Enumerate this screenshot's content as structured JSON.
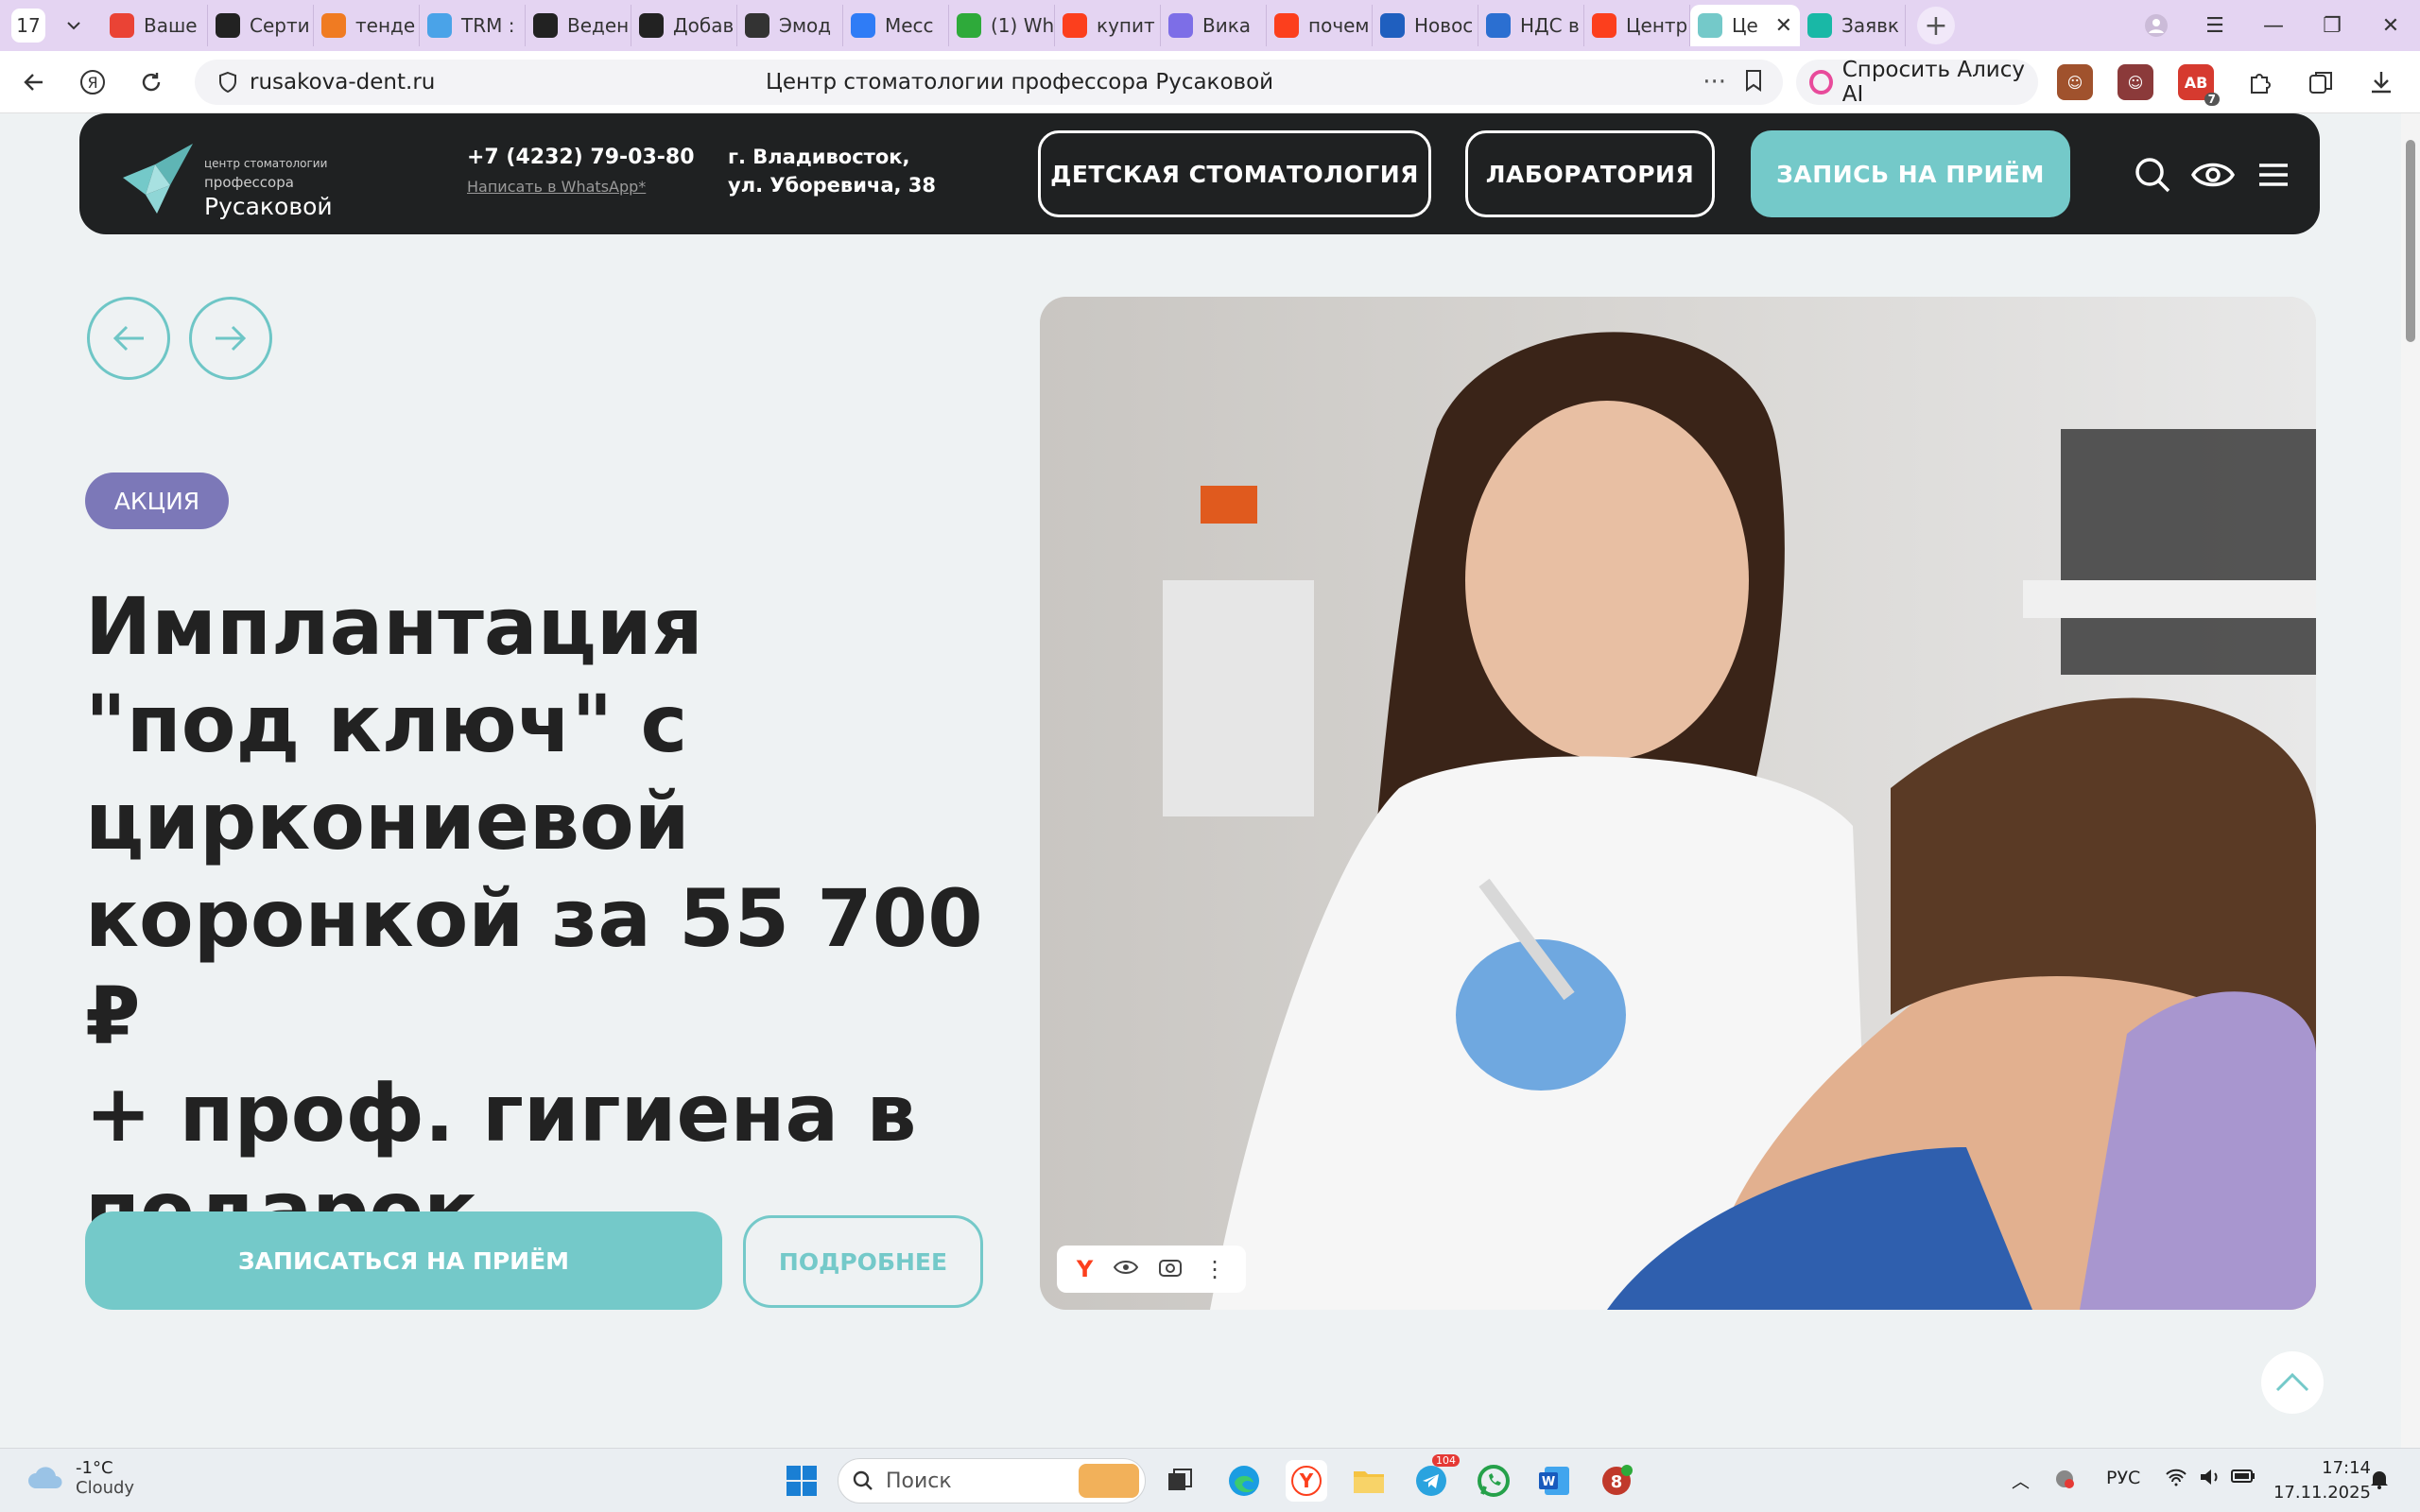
{
  "browser": {
    "tab_count": "17",
    "tabs": [
      {
        "label": "Ваше",
        "icon": "gmail-icon",
        "color": "#ea4335"
      },
      {
        "label": "Серти",
        "icon": "star-badge-icon",
        "color": "#222222"
      },
      {
        "label": "тенде",
        "icon": "mail-icon",
        "color": "#f07b22"
      },
      {
        "label": "TRM :",
        "icon": "trm-icon",
        "color": "#4aa3e8"
      },
      {
        "label": "Веден",
        "icon": "star-badge-icon",
        "color": "#222222"
      },
      {
        "label": "Добав",
        "icon": "star-badge-icon",
        "color": "#222222"
      },
      {
        "label": "Эмод",
        "icon": "openai-icon",
        "color": "#333333"
      },
      {
        "label": "Месс",
        "icon": "messenger-icon",
        "color": "#2f7cf6"
      },
      {
        "label": "(1) Wh",
        "icon": "green-one-icon",
        "color": "#2eaa3a"
      },
      {
        "label": "купит",
        "icon": "yandex-icon",
        "color": "#fc3f1d"
      },
      {
        "label": "Вика",
        "icon": "check-circle-icon",
        "color": "#7d6ee7"
      },
      {
        "label": "почем",
        "icon": "yandex-icon",
        "color": "#fc3f1d"
      },
      {
        "label": "Новос",
        "icon": "news-icon",
        "color": "#1f5fbf"
      },
      {
        "label": "НДС в",
        "icon": "percent-icon",
        "color": "#2b6fd1"
      },
      {
        "label": "Центр",
        "icon": "yandex-icon",
        "color": "#fc3f1d"
      },
      {
        "label": "Це",
        "icon": "origami-bird-icon",
        "color": "#74c9c9",
        "active": true
      },
      {
        "label": "Заявк",
        "icon": "star-green-icon",
        "color": "#19b8a6"
      }
    ],
    "url": "rusakova-dent.ru",
    "page_title": "Центр стоматологии профессора Русаковой",
    "alice_label": "Спросить Алису AI",
    "ext_badge": "7"
  },
  "site": {
    "logo": {
      "line1": "центр стоматологии",
      "line2": "профессора",
      "line3": "Русаковой"
    },
    "phone": "+7 (4232) 79-03-80",
    "whatsapp": "Написать в WhatsApp*",
    "address_line1": "г. Владивосток,",
    "address_line2": "ул. Уборевича, 38",
    "nav": {
      "kids": "ДЕТСКАЯ СТОМАТОЛОГИЯ",
      "lab": "ЛАБОРАТОРИЯ",
      "appointment": "ЗАПИСЬ НА ПРИЁМ"
    },
    "accent_color": "#74c9c9",
    "badge_color": "#7c78b8"
  },
  "hero": {
    "badge": "АКЦИЯ",
    "headline_lines": [
      "Имплантация",
      "\"под ключ\" с",
      "циркониевой",
      "коронкой за 55 700 ₽",
      "+ проф. гигиена в",
      "подарок"
    ],
    "cta_label": "ЗАПИСАТЬСЯ НА ПРИЁМ",
    "more_label": "ПОДРОБНЕЕ"
  },
  "taskbar": {
    "temperature": "-1°C",
    "weather": "Cloudy",
    "search_placeholder": "Поиск",
    "telegram_badge": "104",
    "language": "РУС",
    "time": "17:14",
    "date": "17.11.2025"
  }
}
